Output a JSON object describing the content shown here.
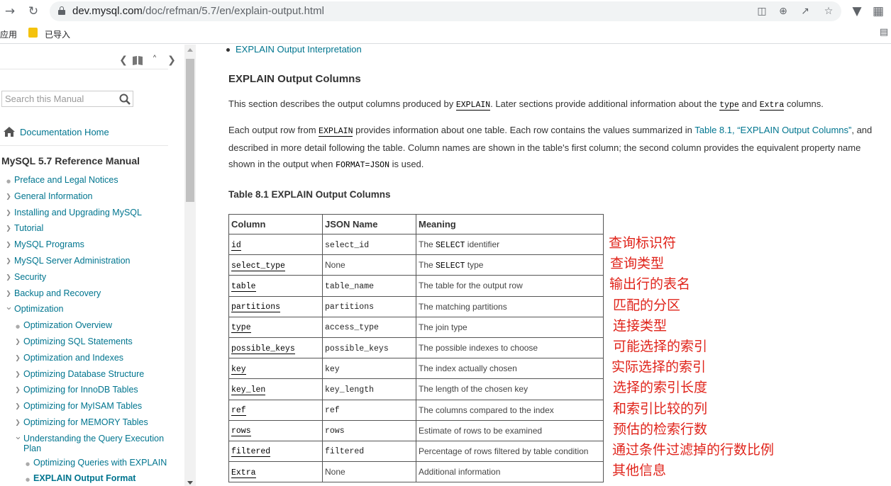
{
  "browser": {
    "url_host": "dev.mysql.com",
    "url_path": "/doc/refman/5.7/en/explain-output.html",
    "bookmarks": {
      "apps_label": "应用",
      "folder_label": "已导入"
    }
  },
  "sidebar": {
    "search_placeholder": "Search this Manual",
    "doc_home": "Documentation Home",
    "manual_title": "MySQL 5.7 Reference Manual",
    "toc": [
      {
        "label": "Preface and Legal Notices",
        "marker": "dot",
        "indent": 0
      },
      {
        "label": "General Information",
        "marker": "right",
        "indent": 0
      },
      {
        "label": "Installing and Upgrading MySQL",
        "marker": "right",
        "indent": 0
      },
      {
        "label": "Tutorial",
        "marker": "right",
        "indent": 0
      },
      {
        "label": "MySQL Programs",
        "marker": "right",
        "indent": 0
      },
      {
        "label": "MySQL Server Administration",
        "marker": "right",
        "indent": 0
      },
      {
        "label": "Security",
        "marker": "right",
        "indent": 0
      },
      {
        "label": "Backup and Recovery",
        "marker": "right",
        "indent": 0
      },
      {
        "label": "Optimization",
        "marker": "down",
        "indent": 0
      },
      {
        "label": "Optimization Overview",
        "marker": "dot",
        "indent": 1
      },
      {
        "label": "Optimizing SQL Statements",
        "marker": "right",
        "indent": 1
      },
      {
        "label": "Optimization and Indexes",
        "marker": "right",
        "indent": 1
      },
      {
        "label": "Optimizing Database Structure",
        "marker": "right",
        "indent": 1
      },
      {
        "label": "Optimizing for InnoDB Tables",
        "marker": "right",
        "indent": 1
      },
      {
        "label": "Optimizing for MyISAM Tables",
        "marker": "right",
        "indent": 1
      },
      {
        "label": "Optimizing for MEMORY Tables",
        "marker": "right",
        "indent": 1
      },
      {
        "label": "Understanding the Query Execution Plan",
        "marker": "down",
        "indent": 1,
        "wrap": true
      },
      {
        "label": "Optimizing Queries with EXPLAIN",
        "marker": "dot",
        "indent": 2
      },
      {
        "label": "EXPLAIN Output Format",
        "marker": "dot",
        "indent": 2,
        "current": true
      }
    ]
  },
  "main": {
    "top_link": "EXPLAIN Output Interpretation",
    "heading": "EXPLAIN Output Columns",
    "p1": {
      "t1": "This section describes the output columns produced by ",
      "c1": "EXPLAIN",
      "t2": ". Later sections provide additional information about the ",
      "c2": "type",
      "t3": " and ",
      "c3": "Extra",
      "t4": " columns."
    },
    "p2": {
      "t1": "Each output row from ",
      "c1": "EXPLAIN",
      "t2": " provides information about one table. Each row contains the values summarized in ",
      "link": "Table 8.1, “EXPLAIN Output Columns”",
      "t3": ", and described in more detail following the table. Column names are shown in the table's first column; the second column provides the equivalent property name shown in the output when ",
      "c2": "FORMAT=JSON",
      "t4": " is used."
    },
    "table_title": "Table 8.1 EXPLAIN Output Columns",
    "table": {
      "headers": [
        "Column",
        "JSON Name",
        "Meaning"
      ],
      "rows": [
        {
          "col": "id",
          "json": "select_id",
          "json_plain": false,
          "m1": "The ",
          "mcode": "SELECT",
          "m2": " identifier",
          "note": "查询标识符"
        },
        {
          "col": "select_type",
          "json": "None",
          "json_plain": true,
          "m1": "The ",
          "mcode": "SELECT",
          "m2": " type",
          "note": "查询类型"
        },
        {
          "col": "table",
          "json": "table_name",
          "json_plain": false,
          "m1": "The table for the output row",
          "mcode": "",
          "m2": "",
          "note": "输出行的表名"
        },
        {
          "col": "partitions",
          "json": "partitions",
          "json_plain": false,
          "m1": "The matching partitions",
          "mcode": "",
          "m2": "",
          "note": "匹配的分区"
        },
        {
          "col": "type",
          "json": "access_type",
          "json_plain": false,
          "m1": "The join type",
          "mcode": "",
          "m2": "",
          "note": "连接类型"
        },
        {
          "col": "possible_keys",
          "json": "possible_keys",
          "json_plain": false,
          "m1": "The possible indexes to choose",
          "mcode": "",
          "m2": "",
          "note": "可能选择的索引"
        },
        {
          "col": "key",
          "json": "key",
          "json_plain": false,
          "m1": "The index actually chosen",
          "mcode": "",
          "m2": "",
          "note": "实际选择的索引"
        },
        {
          "col": "key_len",
          "json": "key_length",
          "json_plain": false,
          "m1": "The length of the chosen key",
          "mcode": "",
          "m2": "",
          "note": "选择的索引长度"
        },
        {
          "col": "ref",
          "json": "ref",
          "json_plain": false,
          "m1": "The columns compared to the index",
          "mcode": "",
          "m2": "",
          "note": "和索引比较的列"
        },
        {
          "col": "rows",
          "json": "rows",
          "json_plain": false,
          "m1": "Estimate of rows to be examined",
          "mcode": "",
          "m2": "",
          "note": "预估的检索行数"
        },
        {
          "col": "filtered",
          "json": "filtered",
          "json_plain": false,
          "m1": "Percentage of rows filtered by table condition",
          "mcode": "",
          "m2": "",
          "note": "通过条件过滤掉的行数比例"
        },
        {
          "col": "Extra",
          "json": "None",
          "json_plain": true,
          "m1": "Additional information",
          "mcode": "",
          "m2": "",
          "note": "其他信息"
        }
      ]
    }
  },
  "colors": {
    "link": "#00758f",
    "annotation": "#e0241b"
  }
}
